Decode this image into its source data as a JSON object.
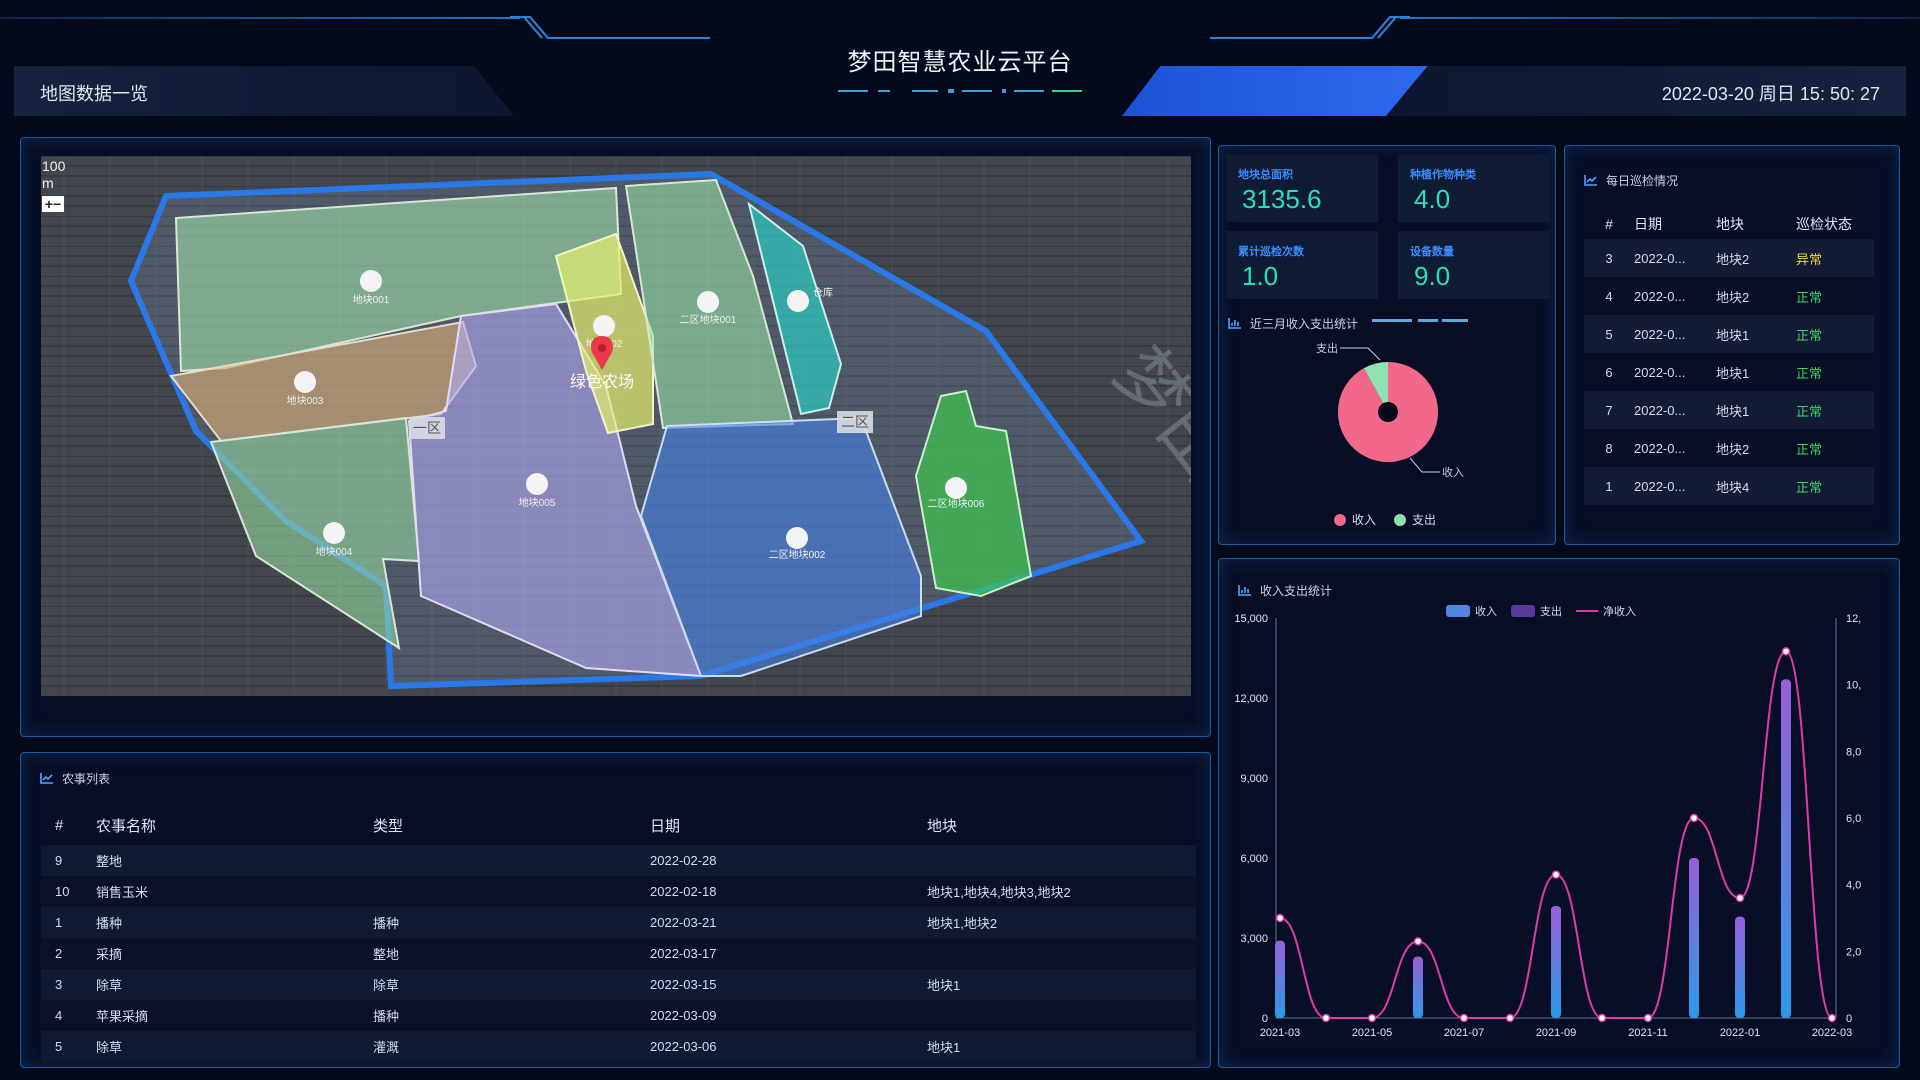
{
  "header": {
    "title": "梦田智慧农业云平台",
    "left_label": "地图数据一览",
    "datetime": "2022-03-20 周日 15: 50: 27"
  },
  "map": {
    "scale_value": "100",
    "scale_unit": "m",
    "zoom_label": "+−",
    "farm_name": "绿色农场",
    "watermark": "梦田科技",
    "zone_labels": [
      "一区",
      "二区"
    ],
    "plots": [
      "地块001",
      "地块002",
      "地块003",
      "地块004",
      "地块005",
      "二区地块001",
      "二区地块002",
      "二区地块006",
      "仓库"
    ]
  },
  "stats": {
    "total_area_label": "地块总面积",
    "total_area": "3135.6",
    "crop_types_label": "种植作物种类",
    "crop_types": "4.0",
    "patrol_count_label": "累计巡检次数",
    "patrol_count": "1.0",
    "device_count_label": "设备数量",
    "device_count": "9.0",
    "pie_title": "近三月收入支出统计",
    "pie_legend": [
      {
        "name": "收入",
        "color": "#f2678a"
      },
      {
        "name": "支出",
        "color": "#8ee3b2"
      }
    ],
    "pie_values": {
      "income": 92,
      "expense": 8
    }
  },
  "patrol": {
    "title": "每日巡检情况",
    "headers": [
      "#",
      "日期",
      "地块",
      "巡检状态"
    ],
    "rows": [
      {
        "no": "3",
        "date": "2022-0...",
        "plot": "地块2",
        "status": "异常",
        "abnormal": true
      },
      {
        "no": "4",
        "date": "2022-0...",
        "plot": "地块2",
        "status": "正常",
        "abnormal": false
      },
      {
        "no": "5",
        "date": "2022-0...",
        "plot": "地块1",
        "status": "正常",
        "abnormal": false
      },
      {
        "no": "6",
        "date": "2022-0...",
        "plot": "地块1",
        "status": "正常",
        "abnormal": false
      },
      {
        "no": "7",
        "date": "2022-0...",
        "plot": "地块1",
        "status": "正常",
        "abnormal": false
      },
      {
        "no": "8",
        "date": "2022-0...",
        "plot": "地块2",
        "status": "正常",
        "abnormal": false
      },
      {
        "no": "1",
        "date": "2022-0...",
        "plot": "地块4",
        "status": "正常",
        "abnormal": false
      }
    ]
  },
  "farming": {
    "title": "农事列表",
    "headers": [
      "#",
      "农事名称",
      "类型",
      "日期",
      "地块"
    ],
    "rows": [
      {
        "no": "9",
        "name": "整地",
        "type": "",
        "date": "2022-02-28",
        "plot": ""
      },
      {
        "no": "10",
        "name": "销售玉米",
        "type": "",
        "date": "2022-02-18",
        "plot": "地块1,地块4,地块3,地块2"
      },
      {
        "no": "1",
        "name": "播种",
        "type": "播种",
        "date": "2022-03-21",
        "plot": "地块1,地块2"
      },
      {
        "no": "2",
        "name": "采摘",
        "type": "整地",
        "date": "2022-03-17",
        "plot": ""
      },
      {
        "no": "3",
        "name": "除草",
        "type": "除草",
        "date": "2022-03-15",
        "plot": "地块1"
      },
      {
        "no": "4",
        "name": "苹果采摘",
        "type": "播种",
        "date": "2022-03-09",
        "plot": ""
      },
      {
        "no": "5",
        "name": "除草",
        "type": "灌溉",
        "date": "2022-03-06",
        "plot": "地块1"
      }
    ]
  },
  "chart_data": {
    "type": "bar",
    "title": "收入支出统计",
    "legend": [
      "收入",
      "支出",
      "净收入"
    ],
    "x": [
      "2021-03",
      "2021-04",
      "2021-05",
      "2021-06",
      "2021-07",
      "2021-08",
      "2021-09",
      "2021-10",
      "2021-11",
      "2021-12",
      "2022-01",
      "2022-02",
      "2022-03"
    ],
    "x_tick_labels": [
      "2021-03",
      "2021-05",
      "2021-07",
      "2021-09",
      "2021-11",
      "2022-01",
      "2022-03"
    ],
    "series": [
      {
        "name": "收入",
        "type": "bar",
        "axis": "left",
        "color": "#3a8ee6",
        "values": [
          2900,
          0,
          0,
          2300,
          0,
          0,
          4200,
          0,
          0,
          6000,
          3800,
          12700,
          0
        ]
      },
      {
        "name": "支出",
        "type": "bar",
        "axis": "left",
        "color": "#5a3aa0",
        "values": [
          0,
          0,
          0,
          0,
          0,
          0,
          0,
          0,
          0,
          0,
          0,
          0,
          0
        ]
      },
      {
        "name": "净收入",
        "type": "line",
        "axis": "right",
        "color": "#e03aa8",
        "values": [
          3.0,
          0,
          0,
          2.3,
          0,
          0,
          4.3,
          0,
          0,
          6.0,
          3.6,
          11.0,
          0
        ]
      }
    ],
    "ylim_left": [
      0,
      15000
    ],
    "ylim_right": [
      0,
      12
    ],
    "y_left_ticks": [
      "0",
      "3,000",
      "6,000",
      "9,000",
      "12,000",
      "15,000"
    ],
    "y_right_ticks": [
      "0",
      "2,0",
      "4,0",
      "6,0",
      "8,0",
      "10,",
      "12,"
    ]
  },
  "colors": {
    "accent_blue": "#1b53d6",
    "teal_value": "#25e0c0",
    "label_blue": "#3c8cff",
    "abnormal": "#f0d43a",
    "normal": "#3ad26a"
  }
}
